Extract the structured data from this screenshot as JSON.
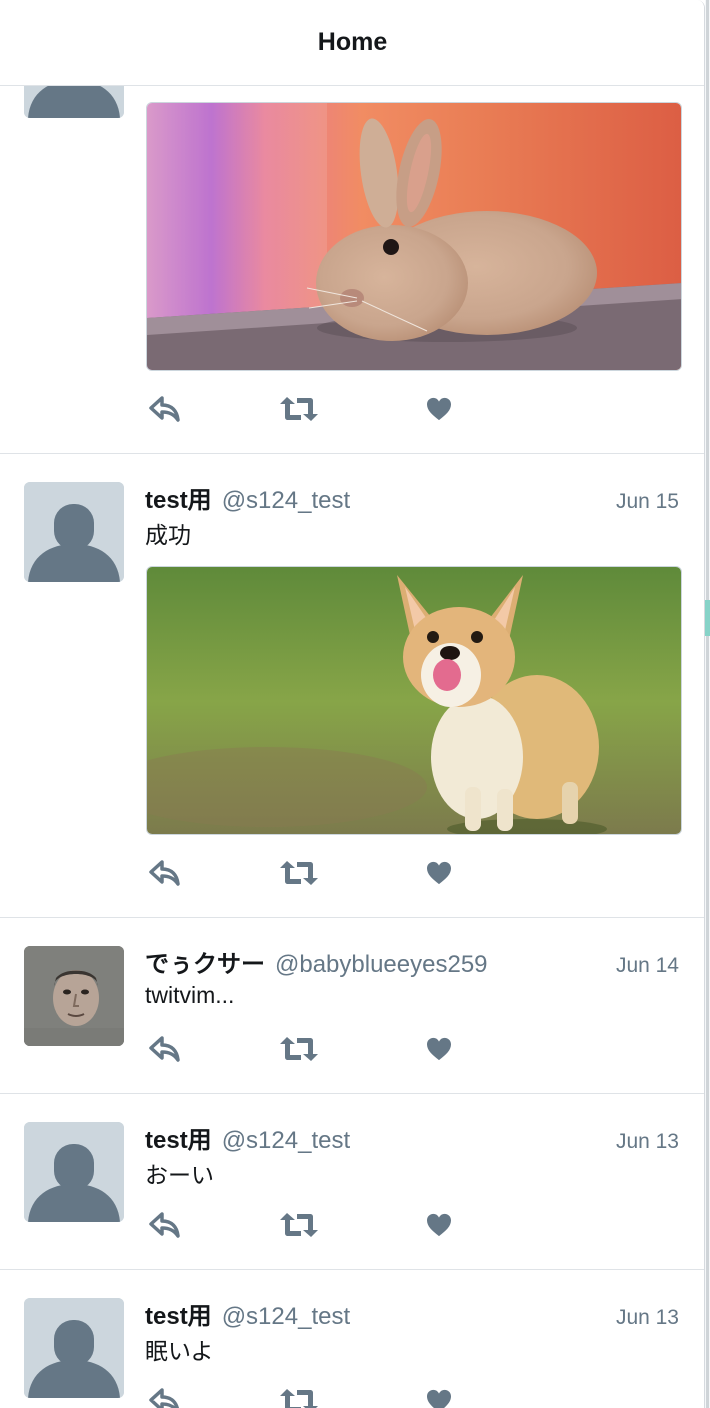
{
  "header": {
    "title": "Home"
  },
  "tweets": [
    {
      "name": "",
      "handle": "",
      "date": "",
      "text": "",
      "media": "rabbit-photo",
      "avatar": "default-avatar-icon"
    },
    {
      "name": "test用",
      "handle": "@s124_test",
      "date": "Jun 15",
      "text": "成功",
      "media": "corgi-photo",
      "avatar": "default-avatar-icon"
    },
    {
      "name": "でぅクサー",
      "handle": "@babyblueeyes259",
      "date": "Jun 14",
      "text": "twitvim...",
      "avatar": "face-photo-avatar"
    },
    {
      "name": "test用",
      "handle": "@s124_test",
      "date": "Jun 13",
      "text": "おーい",
      "avatar": "default-avatar-icon"
    },
    {
      "name": "test用",
      "handle": "@s124_test",
      "date": "Jun 13",
      "text": "眠いよ",
      "avatar": "default-avatar-icon"
    }
  ],
  "actions": {
    "reply_icon": "reply-icon",
    "retweet_icon": "retweet-icon",
    "like_icon": "heart-icon"
  },
  "colors": {
    "icon": "#657786",
    "avatar_bg": "#ccd6dd",
    "border": "#dfe3e7",
    "text": "#14171a",
    "muted": "#657786"
  }
}
